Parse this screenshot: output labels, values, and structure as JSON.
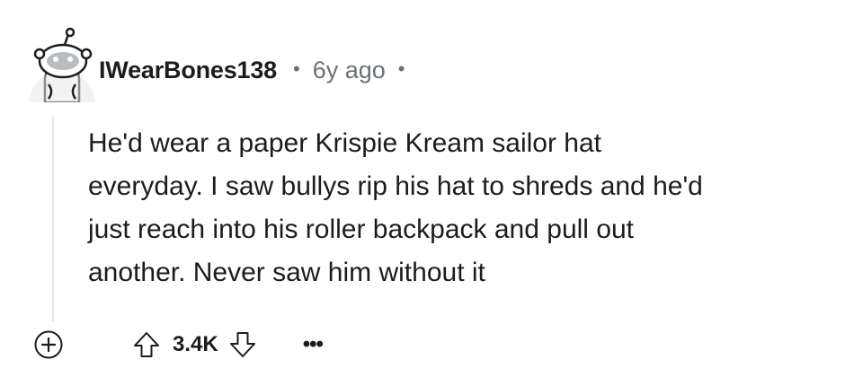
{
  "comment": {
    "author": "IWearBones138",
    "separator": "•",
    "timestamp": "6y ago",
    "body_lines": [
      "He'd wear a paper Krispie Kream sailor hat",
      "everyday. I saw bullys rip his hat to shreds and he'd",
      "just reach into his roller backpack and pull out",
      "another. Never saw him without it"
    ],
    "score": "3.4K",
    "more_label": "•••"
  },
  "icons": {
    "avatar": "snoo-avatar-icon",
    "expand": "plus-circle-icon",
    "upvote": "arrow-up-icon",
    "downvote": "arrow-down-icon"
  },
  "colors": {
    "text": "#1c1c1c",
    "meta": "#6b7074",
    "thread_line": "#e4e6e8"
  }
}
